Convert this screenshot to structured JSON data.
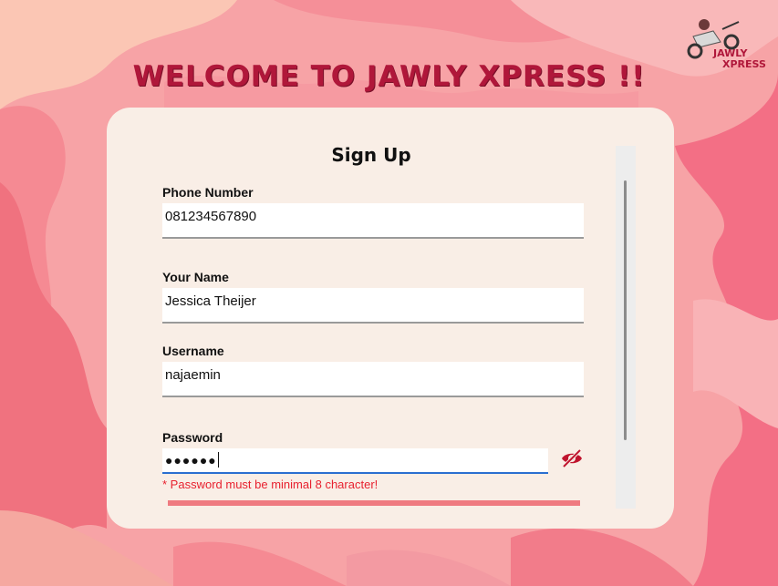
{
  "header": {
    "title": "WELCOME TO JAWLY XPRESS !!"
  },
  "logo": {
    "text_top": "JAWLY",
    "text_bottom": "XPRESS"
  },
  "form": {
    "title": "Sign Up",
    "phone": {
      "label": "Phone Number",
      "value": "081234567890"
    },
    "name": {
      "label": "Your Name",
      "value": "Jessica Theijer"
    },
    "username": {
      "label": "Username",
      "value": "najaemin"
    },
    "password": {
      "label": "Password",
      "value_masked": "●●●●●●",
      "visibility_icon": "eye-slash-icon"
    },
    "error": "* Password must be minimal 8 character!"
  },
  "colors": {
    "accent": "#b0173a",
    "card": "#f9eee6",
    "error": "#e8212f",
    "focus": "#2a6fd0"
  }
}
